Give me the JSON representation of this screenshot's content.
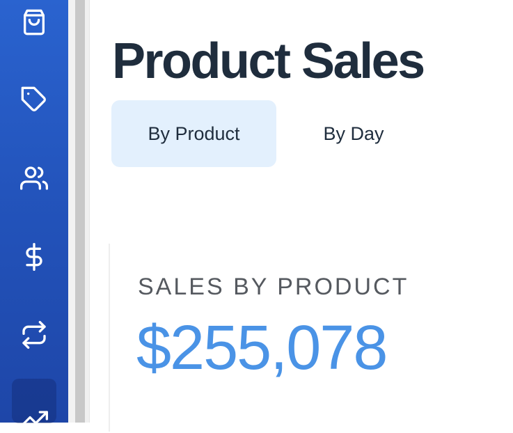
{
  "sidebar": {
    "items": [
      {
        "icon": "shopping-bag-icon"
      },
      {
        "icon": "tag-icon"
      },
      {
        "icon": "users-icon"
      },
      {
        "icon": "dollar-icon"
      },
      {
        "icon": "repeat-icon"
      },
      {
        "icon": "trending-up-icon",
        "active": true
      }
    ]
  },
  "header": {
    "title": "Product Sales"
  },
  "tabs": [
    {
      "label": "By Product",
      "active": true
    },
    {
      "label": "By Day",
      "active": false
    }
  ],
  "summary_card": {
    "label": "SALES BY PRODUCT",
    "value": "$255,078"
  },
  "colors": {
    "sidebar": "#2354bc",
    "title": "#1f2d3d",
    "active_tab": "#e3f0fd",
    "value": "#4a93e6"
  }
}
